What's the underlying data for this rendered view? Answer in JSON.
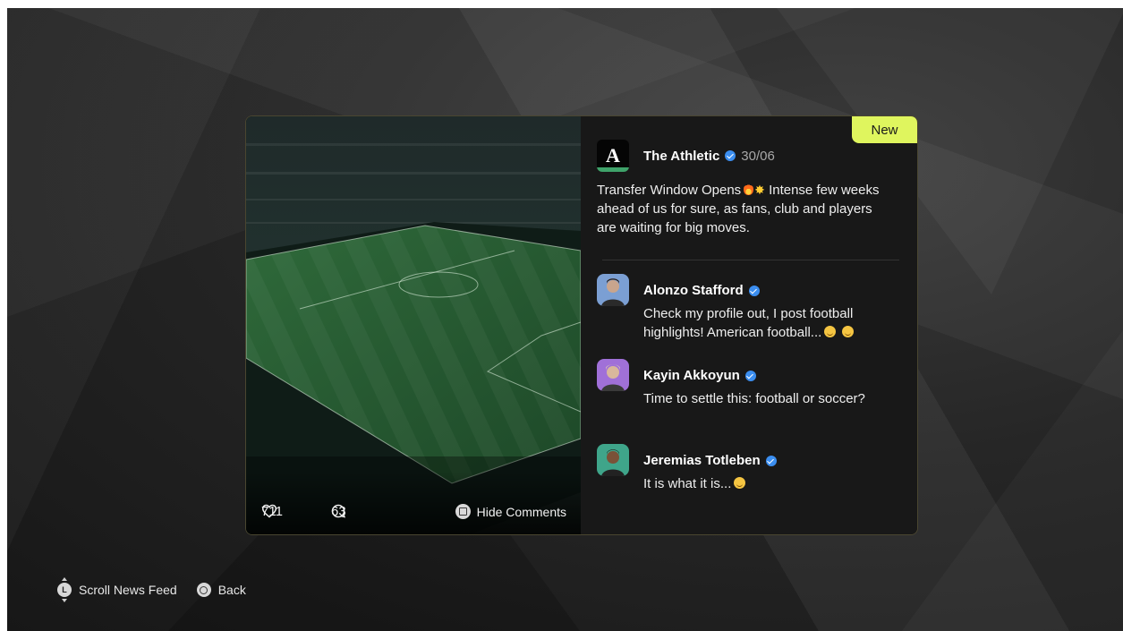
{
  "post": {
    "badge": "New",
    "logo_letter": "A",
    "author": "The Athletic",
    "date": "30/06",
    "text_before_emoji": "Transfer Window Opens",
    "text_after_emoji": " Intense few weeks ahead of us for sure, as fans, club and players are waiting for big moves.",
    "likes": "711",
    "comments": "63",
    "hide_comments_label": "Hide Comments"
  },
  "comments": [
    {
      "name": "Alonzo Stafford",
      "text": "Check my profile out, I post football highlights! American football...",
      "avatar_color": "#5a87c9"
    },
    {
      "name": "Kayin Akkoyun",
      "text": "Time to settle this: football or soccer?",
      "avatar_color": "#a070d8"
    },
    {
      "name": "Jeremias Totleben",
      "text": "It is what it is...",
      "avatar_color": "#3fa58a"
    }
  ],
  "footer": {
    "scroll_label": "Scroll News Feed",
    "scroll_button": "L",
    "back_label": "Back"
  },
  "colors": {
    "accent": "#dff55e",
    "verified": "#3b8ef0"
  }
}
